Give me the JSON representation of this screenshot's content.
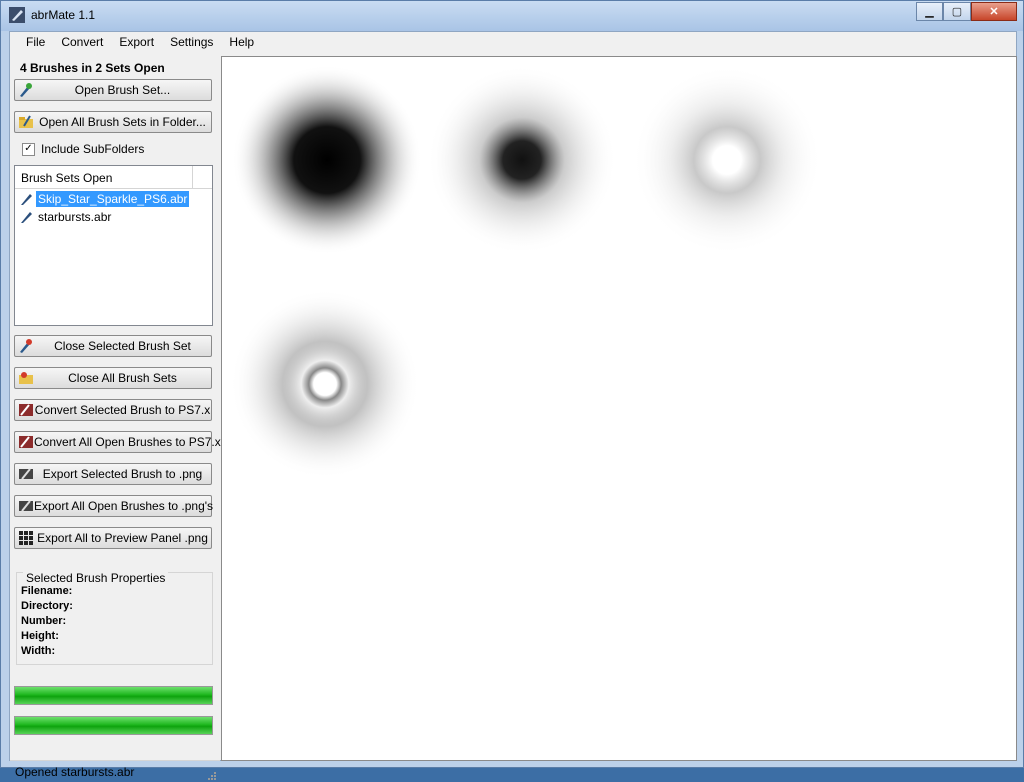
{
  "window": {
    "title": "abrMate 1.1"
  },
  "menu": [
    "File",
    "Convert",
    "Export",
    "Settings",
    "Help"
  ],
  "summary": "4 Brushes in 2 Sets Open",
  "buttons": {
    "open_set": "Open Brush Set...",
    "open_folder": "Open All Brush Sets in Folder...",
    "close_selected": "Close Selected Brush Set",
    "close_all": "Close All Brush Sets",
    "convert_selected": "Convert Selected Brush to PS7.x",
    "convert_all": "Convert All Open Brushes to PS7.x",
    "export_selected": "Export Selected Brush to .png",
    "export_all": "Export All Open Brushes to .png's",
    "export_preview": "Export All to Preview Panel .png"
  },
  "include_subfolders": {
    "label": "Include SubFolders",
    "checked": true
  },
  "brush_sets": {
    "header": "Brush Sets Open",
    "items": [
      {
        "name": "Skip_Star_Sparkle_PS6.abr",
        "selected": true
      },
      {
        "name": "starbursts.abr",
        "selected": false
      }
    ]
  },
  "properties": {
    "title": "Selected Brush Properties",
    "labels": [
      "Filename:",
      "Directory:",
      "Number:",
      "Height:",
      "Width:"
    ]
  },
  "progress": [
    1.0,
    1.0
  ],
  "status": "Opened starbursts.abr",
  "colors": {
    "selection": "#3399ff",
    "progress": "#1fb81f"
  }
}
